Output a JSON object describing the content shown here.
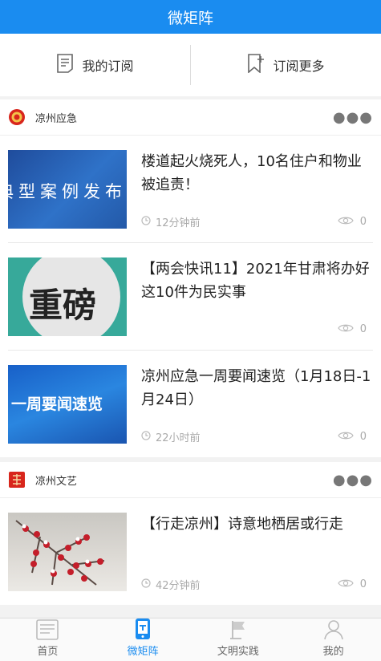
{
  "header": {
    "title": "微矩阵"
  },
  "subbar": {
    "my_subscriptions": "我的订阅",
    "subscribe_more": "订阅更多"
  },
  "sections": [
    {
      "name": "凉州应急",
      "articles": [
        {
          "title": "楼道起火烧死人，10名住户和物业被追责！",
          "thumb_text": "典型案例发布",
          "time": "12分钟前",
          "views": "0"
        },
        {
          "title": "【两会快讯11】2021年甘肃将办好这10件为民实事",
          "thumb_text": "重磅",
          "time": "",
          "views": "0"
        },
        {
          "title": "凉州应急一周要闻速览（1月18日-1月24日）",
          "thumb_text": "一周要闻速览",
          "time": "22小时前",
          "views": "0"
        }
      ]
    },
    {
      "name": "凉州文艺",
      "articles": [
        {
          "title": "【行走凉州】诗意地栖居或行走",
          "time": "42分钟前",
          "views": "0"
        }
      ]
    }
  ],
  "tabs": {
    "home": "首页",
    "matrix": "微矩阵",
    "civilization": "文明实践",
    "mine": "我的"
  },
  "colors": {
    "brand": "#1a8cf0"
  }
}
